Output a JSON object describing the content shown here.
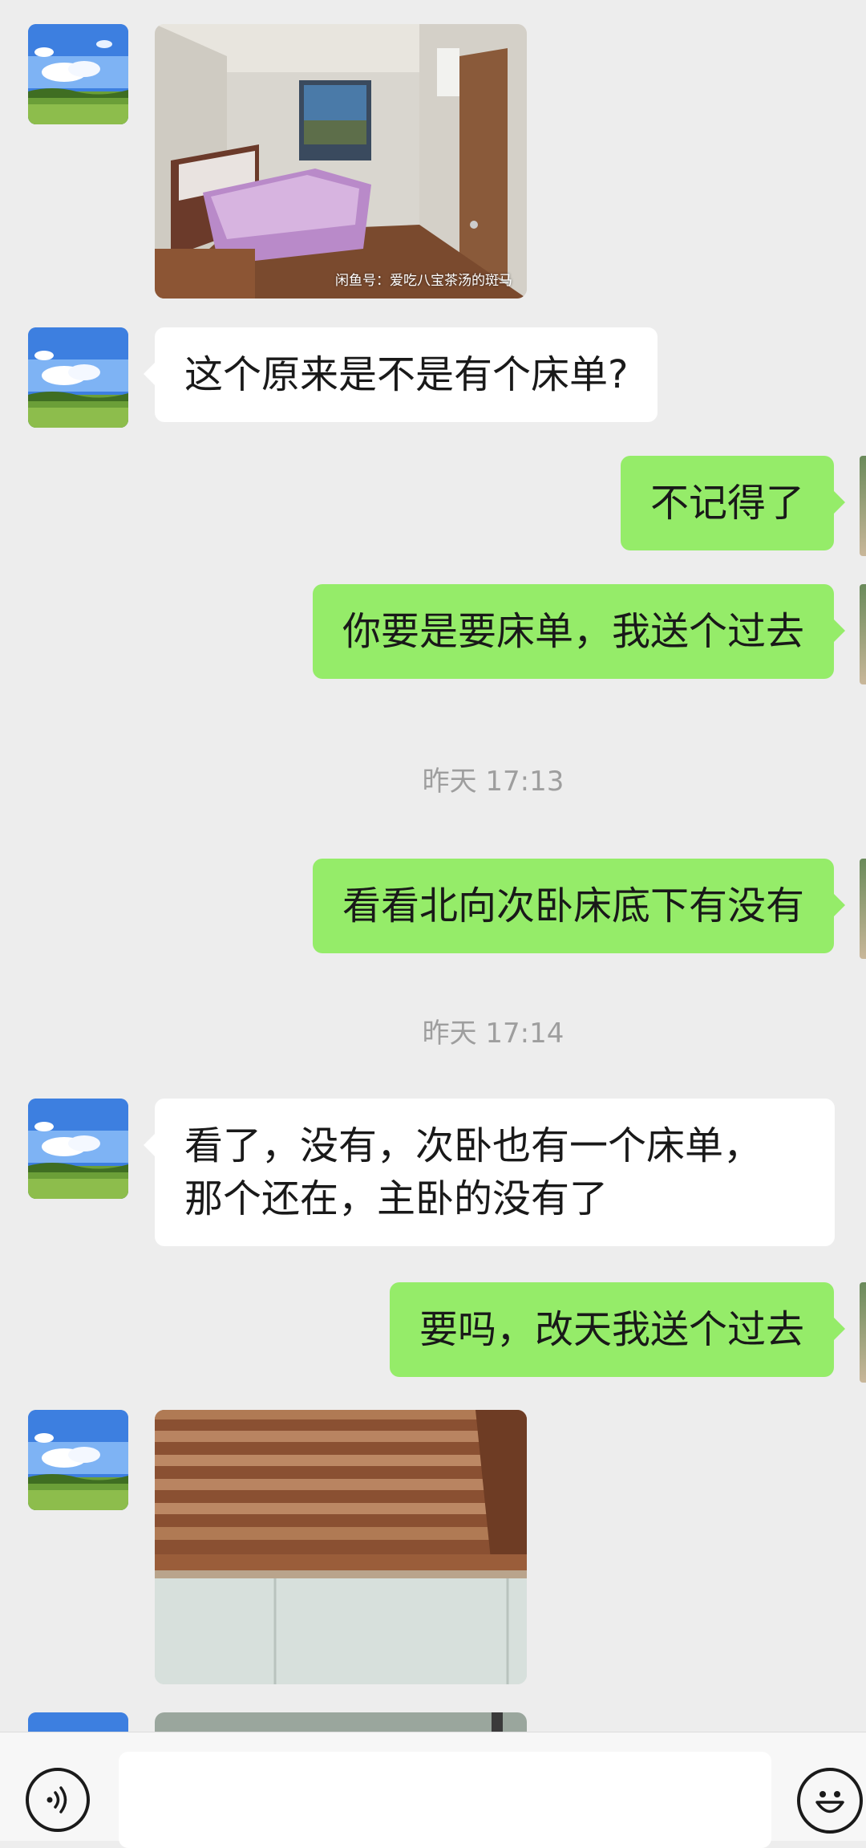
{
  "messages": [
    {
      "from": "other",
      "type": "image",
      "image": "bedroom-photo",
      "watermark": "闲鱼号：爱吃八宝茶汤的斑马"
    },
    {
      "from": "other",
      "type": "text",
      "text": "这个原来是不是有个床单?"
    },
    {
      "from": "me",
      "type": "text",
      "text": "不记得了"
    },
    {
      "from": "me",
      "type": "text",
      "text": "你要是要床单，我送个过去"
    },
    {
      "type": "timestamp",
      "text": "昨天 17:13"
    },
    {
      "from": "me",
      "type": "text",
      "text": "看看北向次卧床底下有没有"
    },
    {
      "type": "timestamp",
      "text": "昨天 17:14"
    },
    {
      "from": "other",
      "type": "text",
      "line1": "看了，没有，次卧也有一个床单，",
      "line2": "那个还在，主卧的没有了"
    },
    {
      "from": "me",
      "type": "text",
      "text": "要吗，改天我送个过去"
    },
    {
      "from": "other",
      "type": "image",
      "image": "bed-frame-photo"
    },
    {
      "from": "other",
      "type": "image",
      "image": "partial-photo"
    }
  ],
  "input_bar": {
    "voice_icon": "voice-icon",
    "input_value": "",
    "emoji_icon": "emoji-icon"
  },
  "colors": {
    "background": "#ededed",
    "incoming_bubble": "#ffffff",
    "outgoing_bubble": "#95ec69",
    "timestamp_text": "#9e9e9e"
  }
}
